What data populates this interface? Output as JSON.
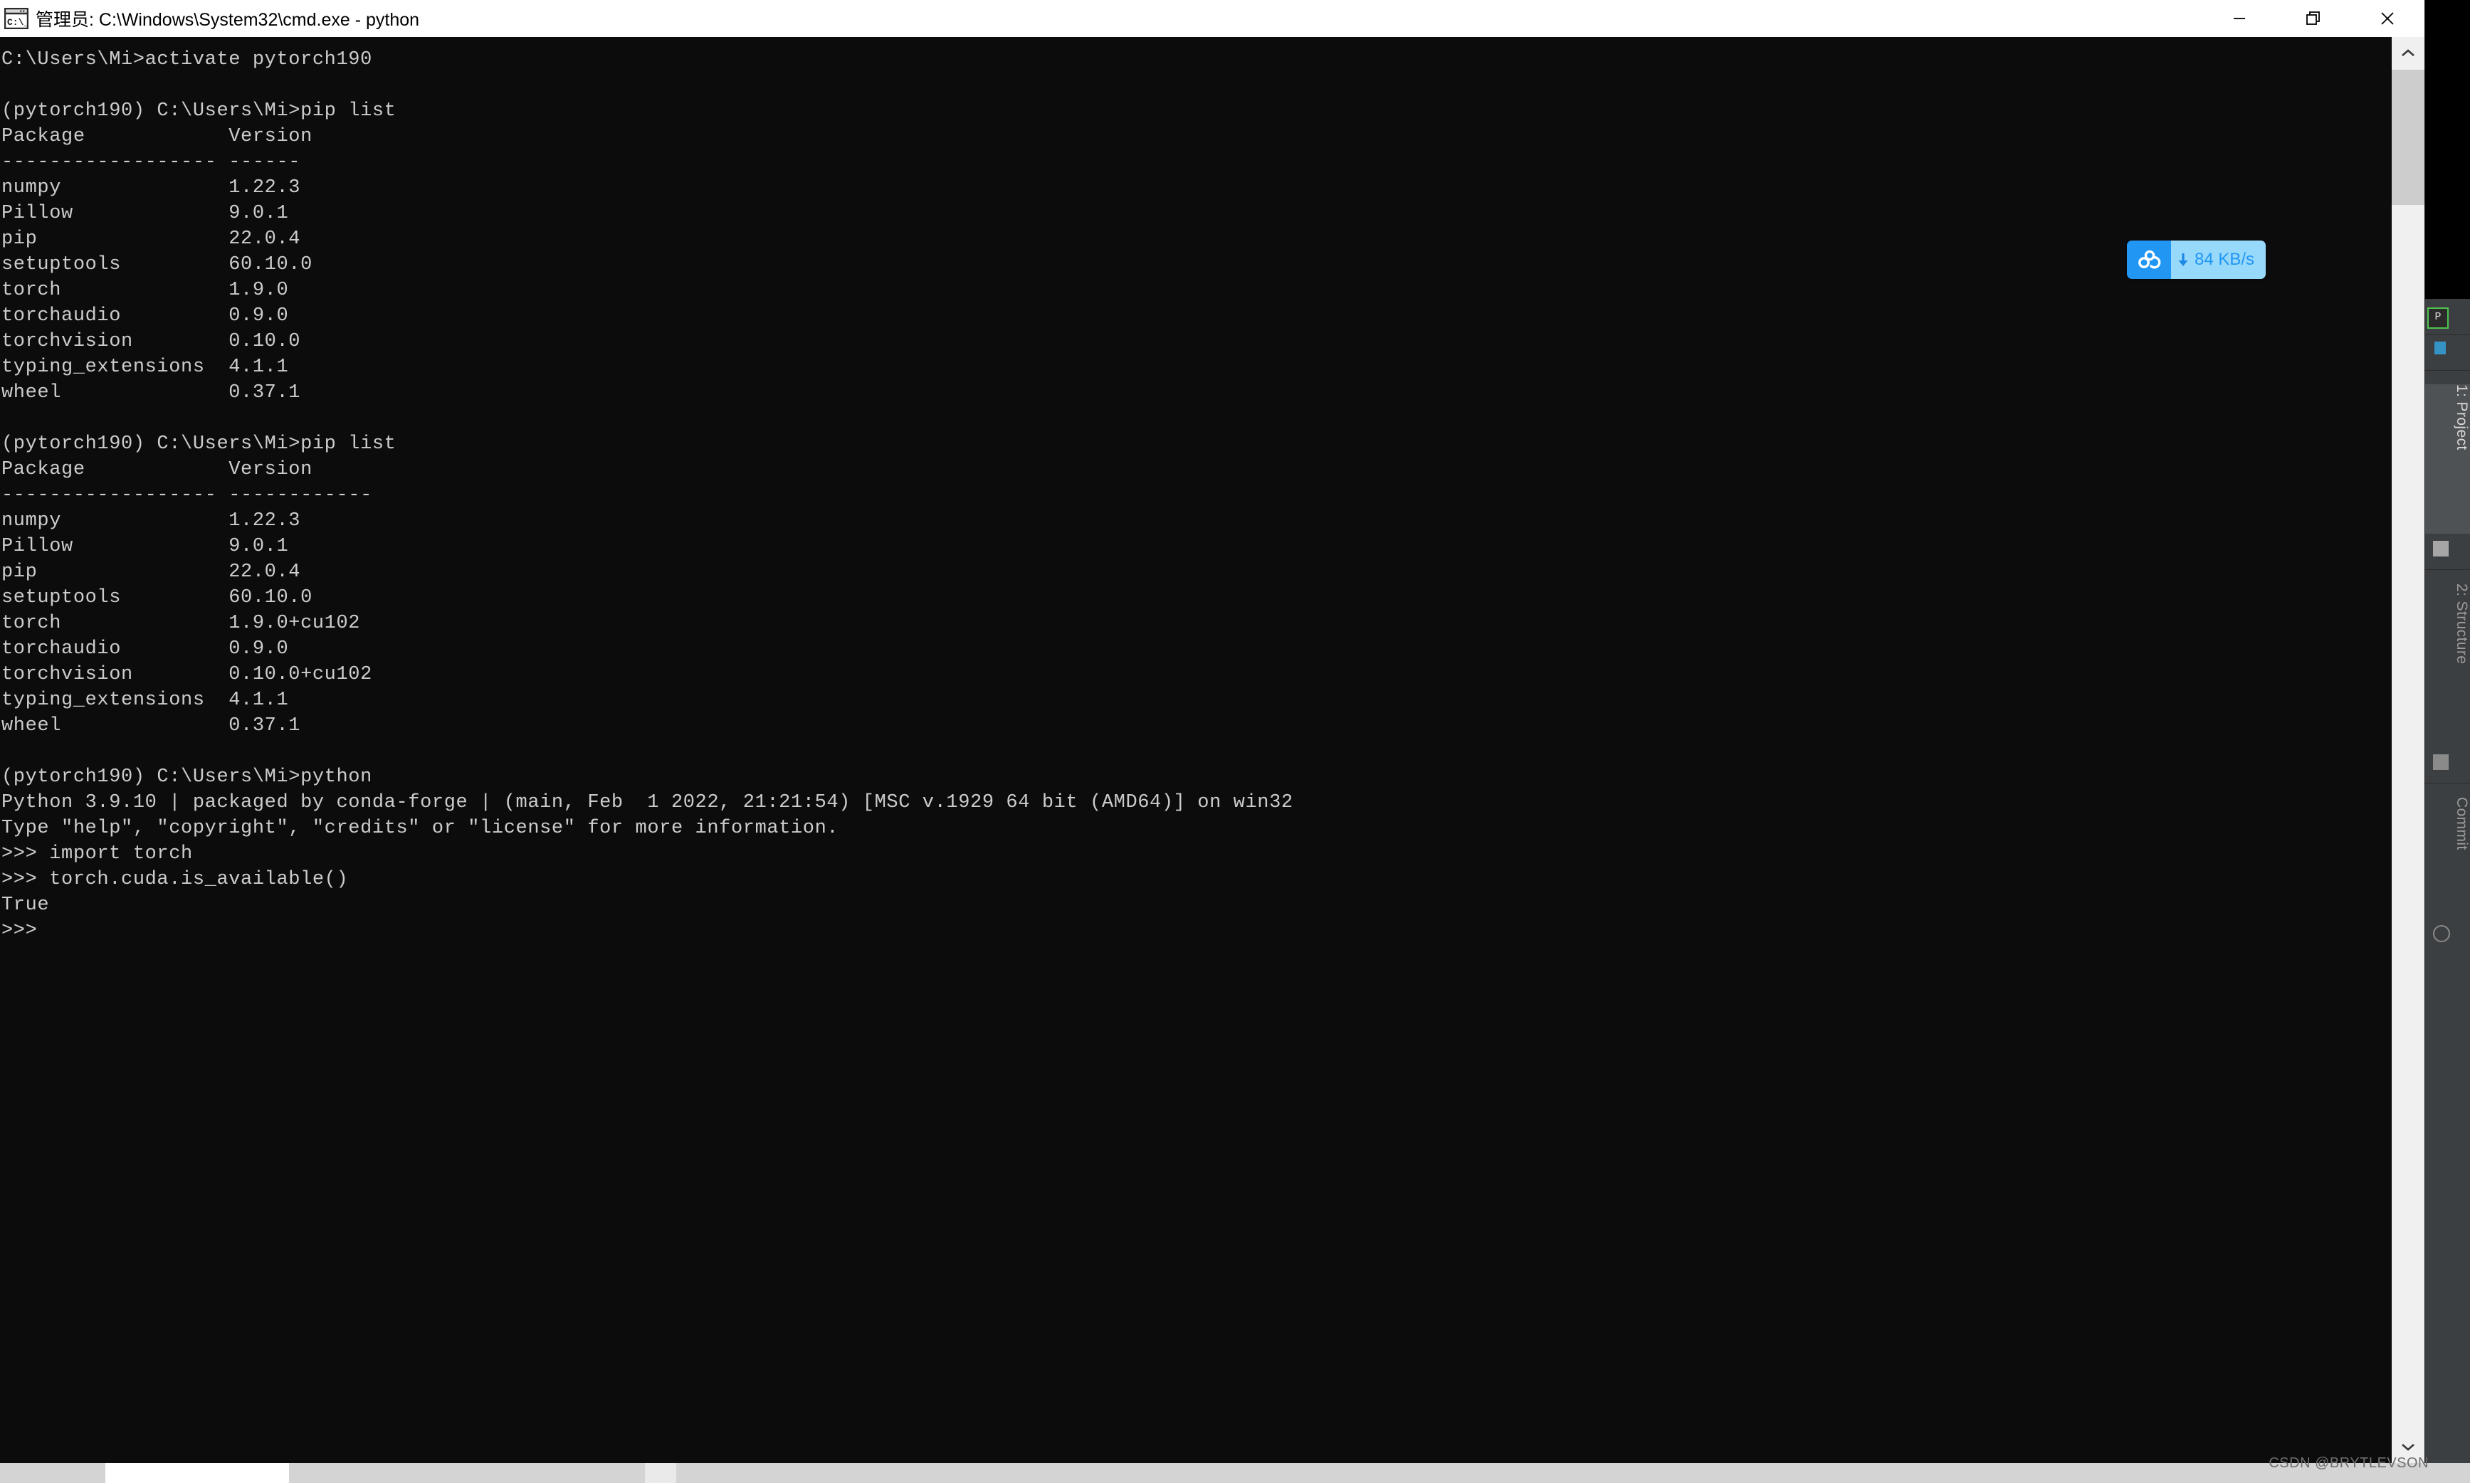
{
  "window": {
    "title": "管理员: C:\\Windows\\System32\\cmd.exe - python",
    "icon": "cmd-prompt-icon",
    "controls": {
      "minimize": "minimize-icon",
      "restore": "restore-icon",
      "close": "close-icon"
    }
  },
  "terminal": {
    "background": "#0c0c0c",
    "foreground": "#cccccc",
    "lines": [
      "C:\\Users\\Mi>activate pytorch190",
      "",
      "(pytorch190) C:\\Users\\Mi>pip list",
      "Package            Version",
      "------------------ ------",
      "numpy              1.22.3",
      "Pillow             9.0.1",
      "pip                22.0.4",
      "setuptools         60.10.0",
      "torch              1.9.0",
      "torchaudio         0.9.0",
      "torchvision        0.10.0",
      "typing_extensions  4.1.1",
      "wheel              0.37.1",
      "",
      "(pytorch190) C:\\Users\\Mi>pip list",
      "Package            Version",
      "------------------ ------------",
      "numpy              1.22.3",
      "Pillow             9.0.1",
      "pip                22.0.4",
      "setuptools         60.10.0",
      "torch              1.9.0+cu102",
      "torchaudio         0.9.0",
      "torchvision        0.10.0+cu102",
      "typing_extensions  4.1.1",
      "wheel              0.37.1",
      "",
      "(pytorch190) C:\\Users\\Mi>python",
      "Python 3.9.10 | packaged by conda-forge | (main, Feb  1 2022, 21:21:54) [MSC v.1929 64 bit (AMD64)] on win32",
      "Type \"help\", \"copyright\", \"credits\" or \"license\" for more information.",
      ">>> import torch",
      ">>> torch.cuda.is_available()",
      "True",
      ">>> "
    ]
  },
  "pip_list_1": {
    "columns": [
      "Package",
      "Version"
    ],
    "rows": [
      [
        "numpy",
        "1.22.3"
      ],
      [
        "Pillow",
        "9.0.1"
      ],
      [
        "pip",
        "22.0.4"
      ],
      [
        "setuptools",
        "60.10.0"
      ],
      [
        "torch",
        "1.9.0"
      ],
      [
        "torchaudio",
        "0.9.0"
      ],
      [
        "torchvision",
        "0.10.0"
      ],
      [
        "typing_extensions",
        "4.1.1"
      ],
      [
        "wheel",
        "0.37.1"
      ]
    ]
  },
  "pip_list_2": {
    "columns": [
      "Package",
      "Version"
    ],
    "rows": [
      [
        "numpy",
        "1.22.3"
      ],
      [
        "Pillow",
        "9.0.1"
      ],
      [
        "pip",
        "22.0.4"
      ],
      [
        "setuptools",
        "60.10.0"
      ],
      [
        "torch",
        "1.9.0+cu102"
      ],
      [
        "torchaudio",
        "0.9.0"
      ],
      [
        "torchvision",
        "0.10.0+cu102"
      ],
      [
        "typing_extensions",
        "4.1.1"
      ],
      [
        "wheel",
        "0.37.1"
      ]
    ]
  },
  "python_session": {
    "prompt": "(pytorch190) C:\\Users\\Mi>python",
    "banner": "Python 3.9.10 | packaged by conda-forge | (main, Feb  1 2022, 21:21:54) [MSC v.1929 64 bit (AMD64)] on win32",
    "help_line": "Type \"help\", \"copyright\", \"credits\" or \"license\" for more information.",
    "commands": [
      ">>> import torch",
      ">>> torch.cuda.is_available()"
    ],
    "result": "True",
    "final_prompt": ">>>"
  },
  "speed_widget": {
    "app": "baidu-netdisk",
    "direction": "download",
    "value": "84 KB/s",
    "accent": "#2196f3",
    "panel": "#97d9fb"
  },
  "ide_background": {
    "tabs": [
      {
        "label": "1: Project",
        "selected": true
      },
      {
        "label": "2: Structure",
        "selected": false
      },
      {
        "label": "Commit",
        "selected": false
      }
    ]
  },
  "scrollbars": {
    "vertical_up": "chevron-up-icon",
    "vertical_down": "chevron-down-icon"
  },
  "watermark": "CSDN @BRYTLEVSON"
}
